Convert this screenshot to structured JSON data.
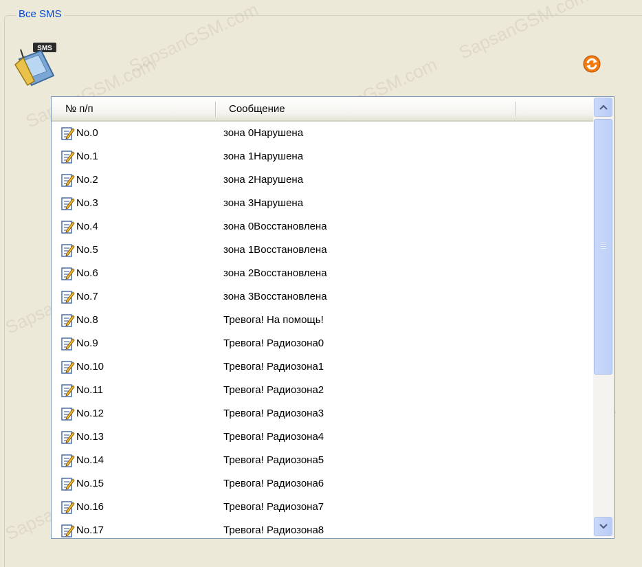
{
  "group": {
    "title": "Все SMS"
  },
  "icons": {
    "sms": "sms-phone-icon",
    "refresh": "refresh-icon",
    "row": "edit-note-icon"
  },
  "sms_icon_text": "SMS",
  "list": {
    "columns": [
      "№ п/п",
      "Сообщение"
    ],
    "rows": [
      {
        "num": "No.0",
        "msg": "зона 0Нарушена"
      },
      {
        "num": "No.1",
        "msg": "зона 1Нарушена"
      },
      {
        "num": "No.2",
        "msg": "зона 2Нарушена"
      },
      {
        "num": "No.3",
        "msg": "зона 3Нарушена"
      },
      {
        "num": "No.4",
        "msg": "зона 0Восстановлена"
      },
      {
        "num": "No.5",
        "msg": "зона 1Восстановлена"
      },
      {
        "num": "No.6",
        "msg": "зона 2Восстановлена"
      },
      {
        "num": "No.7",
        "msg": "зона 3Восстановлена"
      },
      {
        "num": "No.8",
        "msg": "Тревога! На помощь!"
      },
      {
        "num": "No.9",
        "msg": "Тревога! Радиозона0"
      },
      {
        "num": "No.10",
        "msg": "Тревога! Радиозона1"
      },
      {
        "num": "No.11",
        "msg": "Тревога! Радиозона2"
      },
      {
        "num": "No.12",
        "msg": "Тревога! Радиозона3"
      },
      {
        "num": "No.13",
        "msg": "Тревога! Радиозона4"
      },
      {
        "num": "No.14",
        "msg": "Тревога! Радиозона5"
      },
      {
        "num": "No.15",
        "msg": "Тревога! Радиозона6"
      },
      {
        "num": "No.16",
        "msg": "Тревога! Радиозона7"
      },
      {
        "num": "No.17",
        "msg": "Тревога! Радиозона8"
      }
    ]
  },
  "watermark": "SapsanGSM.com",
  "colors": {
    "title": "#0046d5",
    "background": "#ece9d8",
    "border": "#7f9db9",
    "refresh": "#f07800"
  }
}
